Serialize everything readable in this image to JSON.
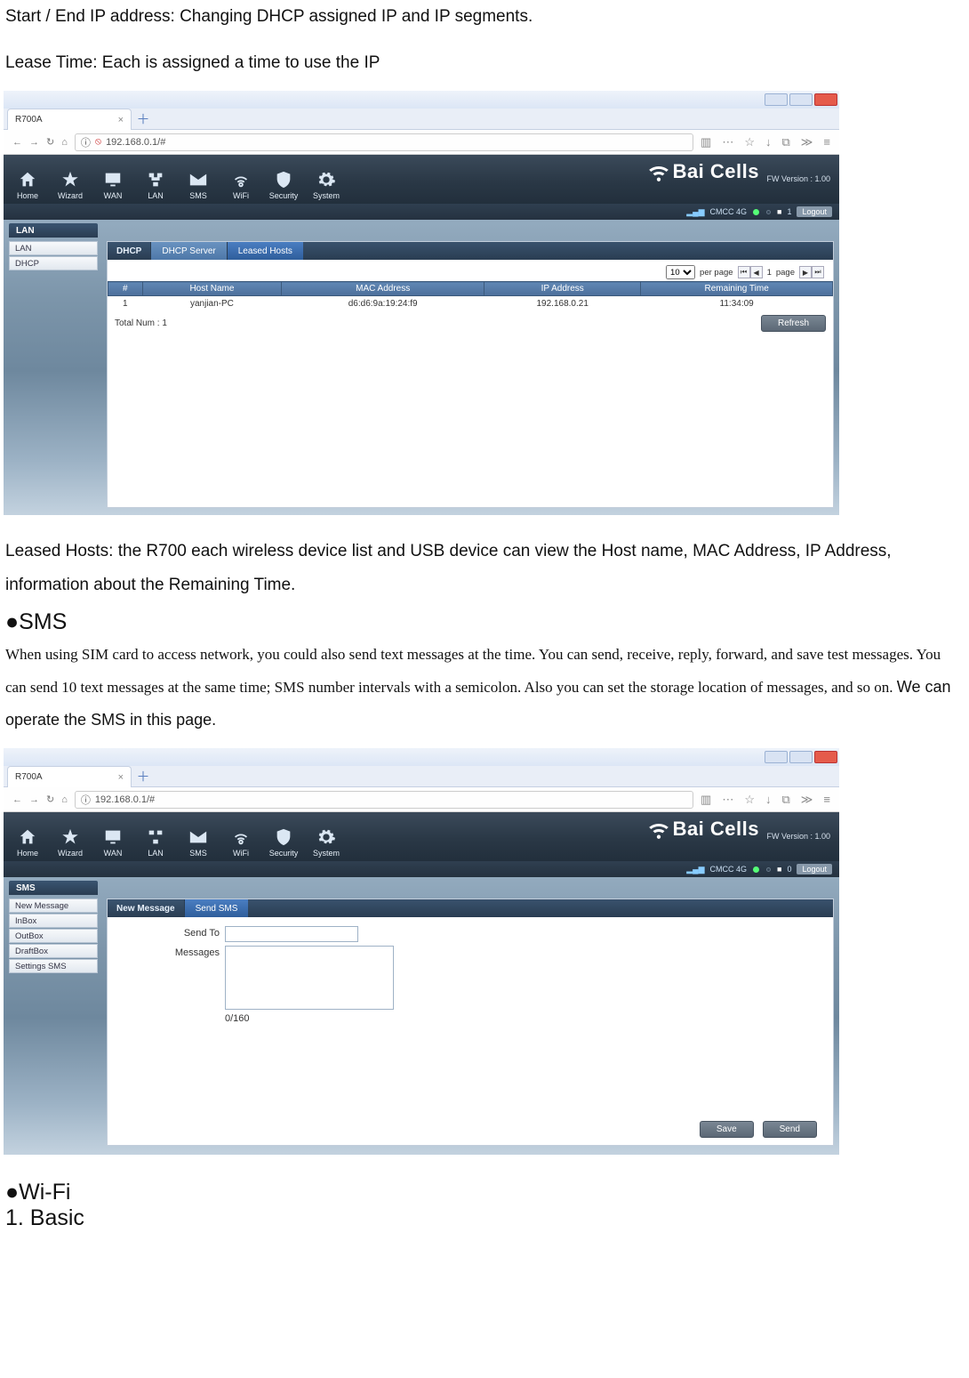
{
  "doc": {
    "p1": "Start / End IP address: Changing DHCP assigned IP and IP segments.",
    "p2": "Lease Time: Each is assigned a time to use the IP",
    "p3": "Leased Hosts: the R700 each wireless device list and USB device can view the Host name, MAC Address, IP Address, information about the Remaining Time.",
    "h_sms": "●SMS",
    "p_sms": "When using SIM card to access network, you could also send text messages at the time. You can send, receive, reply, forward, and save test messages. You can send 10 text messages at the same time; SMS number intervals with a semicolon. Also you can set the storage location of messages, and so on. ",
    "p_sms_tail": "We can operate the SMS in this page.",
    "h_wifi": "●Wi-Fi",
    "h_basic": "1. Basic"
  },
  "browser": {
    "tab_title": "R700A",
    "url": "192.168.0.1/#"
  },
  "router": {
    "brand": "Bai Cells",
    "fw": "FW Version : 1.00",
    "nav": [
      "Home",
      "Wizard",
      "WAN",
      "LAN",
      "SMS",
      "WiFi",
      "Security",
      "System"
    ],
    "status_carrier": "CMCC  4G",
    "status_count1": "1",
    "status_count2": "0",
    "logout": "Logout",
    "per_page": "10",
    "per_page_label": "per page",
    "page_num": "1",
    "page_label": "page"
  },
  "shot1": {
    "section": "LAN",
    "side": [
      "LAN",
      "DHCP"
    ],
    "panel_title": "DHCP",
    "tabs": [
      "DHCP Server",
      "Leased Hosts"
    ],
    "active_tab": 1,
    "columns": [
      "#",
      "Host Name",
      "MAC Address",
      "IP Address",
      "Remaining Time"
    ],
    "rows": [
      {
        "n": "1",
        "host": "yanjian-PC",
        "mac": "d6:d6:9a:19:24:f9",
        "ip": "192.168.0.21",
        "time": "11:34:09"
      }
    ],
    "total_label": "Total Num : 1",
    "refresh": "Refresh"
  },
  "shot2": {
    "section": "SMS",
    "side": [
      "New Message",
      "InBox",
      "OutBox",
      "DraftBox",
      "Settings SMS"
    ],
    "panel_title": "New Message",
    "tabs": [
      "Send SMS"
    ],
    "form": {
      "send_to": "Send To",
      "messages": "Messages",
      "counter": "0/160",
      "save": "Save",
      "send": "Send"
    }
  }
}
